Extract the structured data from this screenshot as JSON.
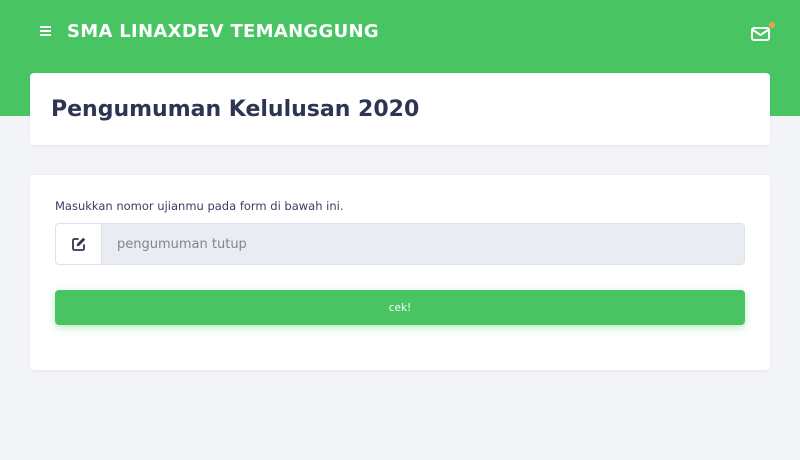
{
  "header": {
    "brand": "SMA LINAXDEV TEMANGGUNG",
    "menu_icon": "hamburger-icon",
    "mail_icon": "envelope-icon",
    "notification_dot_color": "#f0a24a",
    "background_color": "#48c462"
  },
  "page": {
    "title": "Pengumuman Kelulusan 2020"
  },
  "form": {
    "instruction": "Masukkan nomor ujianmu pada form di bawah ini.",
    "input_icon": "edit-icon",
    "input_placeholder": "pengumuman tutup",
    "input_value": "",
    "submit_label": "cek!"
  },
  "colors": {
    "accent": "#48c462",
    "page_background": "#f3f4f8",
    "title_text": "#2e3553"
  }
}
